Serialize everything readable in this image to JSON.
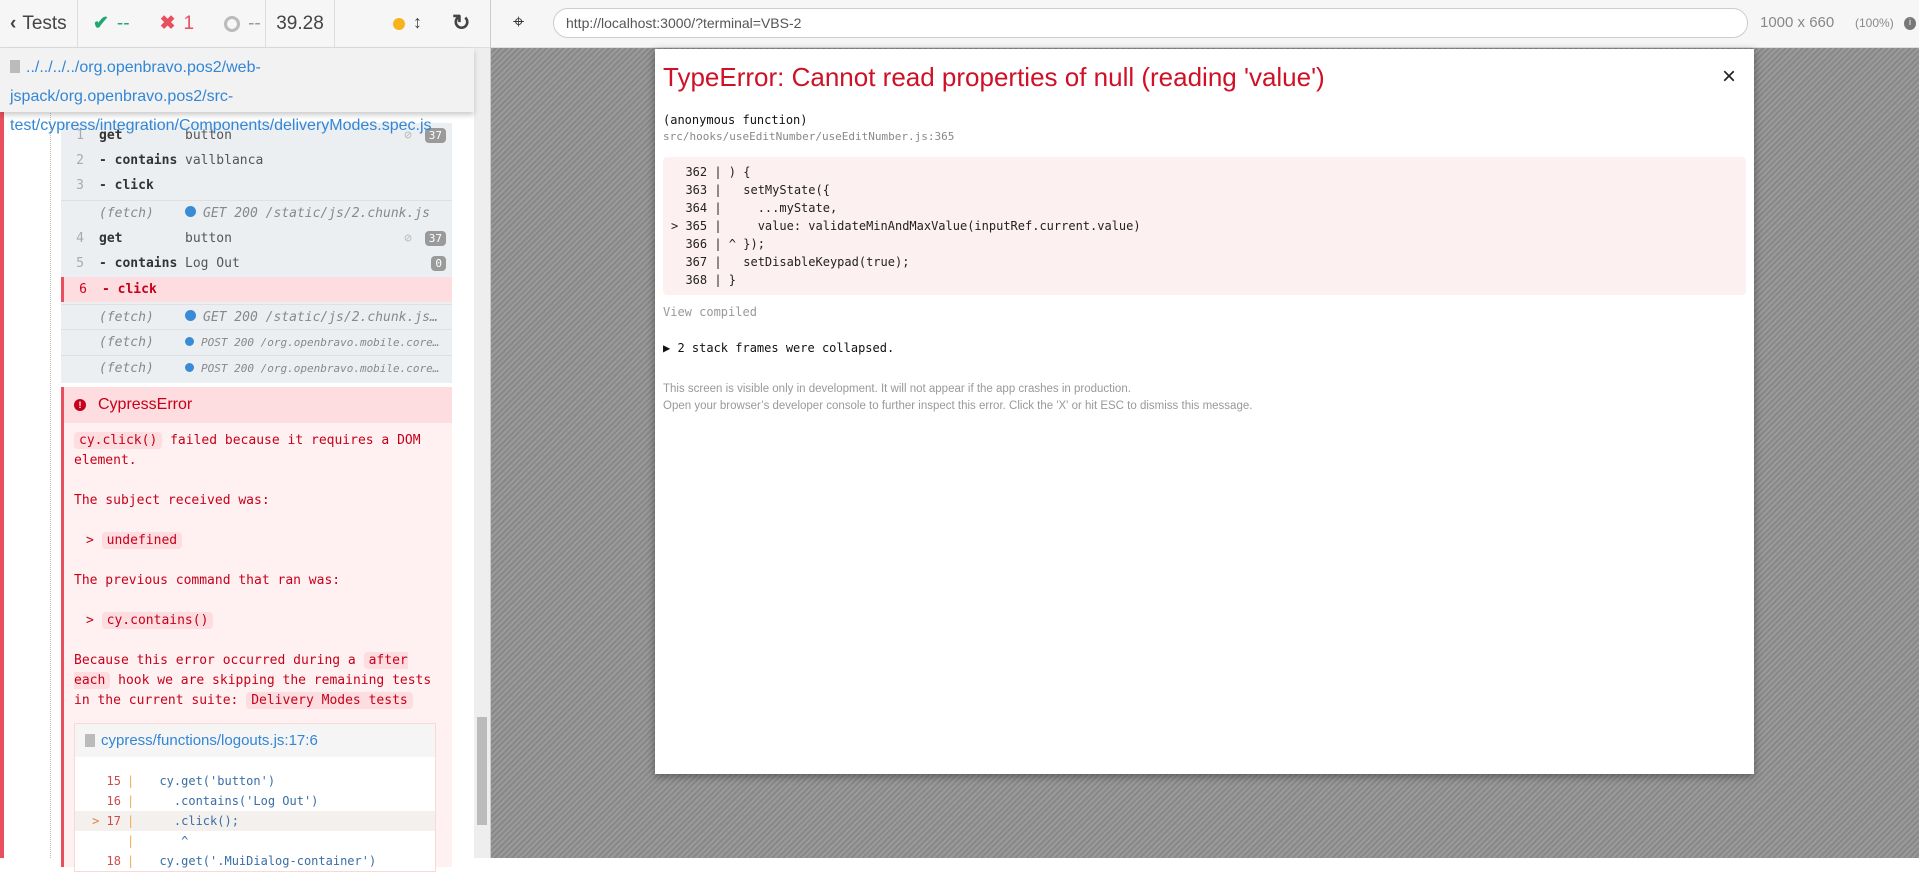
{
  "header": {
    "back_label": "Tests",
    "passed": "--",
    "failed": "1",
    "pending": "--",
    "duration": "39.28"
  },
  "browser": {
    "url": "http://localhost:3000/?terminal=VBS-2",
    "viewport": "1000 x 660",
    "zoom": "(100%)"
  },
  "spec_path": "../../../../org.openbravo.pos2/web-jspack/org.openbravo.pos2/src-test/cypress/integration/Components/deliveryModes.spec.js",
  "commands": [
    {
      "num": "1",
      "name": "get",
      "msg": "button",
      "badge": "37",
      "hidden": true
    },
    {
      "num": "2",
      "name": "- contains",
      "msg": "vallblanca"
    },
    {
      "num": "3",
      "name": "- click",
      "msg": ""
    },
    {
      "num": "",
      "name": "(fetch)",
      "msg": "GET 200 /static/js/2.chunk.js",
      "fetch": true
    },
    {
      "num": "4",
      "name": "get",
      "msg": "button",
      "badge": "37",
      "hidden": true
    },
    {
      "num": "5",
      "name": "- contains",
      "msg": "Log Out",
      "badge": "0"
    },
    {
      "num": "6",
      "name": "- click",
      "msg": "",
      "failed": true
    },
    {
      "num": "",
      "name": "(fetch)",
      "msg": "GET 200 /static/js/2.chunk.js…",
      "fetch": true
    },
    {
      "num": "",
      "name": "(fetch)",
      "msg": "POST 200 /org.openbravo.mobile.core…",
      "fetch": true
    },
    {
      "num": "",
      "name": "(fetch)",
      "msg": "POST 200 /org.openbravo.mobile.core…",
      "fetch": true
    }
  ],
  "error": {
    "name": "CypressError",
    "code1": "cy.click()",
    "text1": " failed because it requires a DOM element.",
    "text2": "The subject received was:",
    "code2": "undefined",
    "text3": "The previous command that ran was:",
    "code3": "cy.contains()",
    "text4a": "Because this error occurred during a ",
    "code4": "after each",
    "text4b": " hook we are skipping the remaining tests in the current suite: ",
    "code5": "Delivery Modes tests",
    "file": "cypress/functions/logouts.js:17:6",
    "lines": [
      {
        "marker": "",
        "num": "15",
        "code": "  cy.get('button')"
      },
      {
        "marker": "",
        "num": "16",
        "code": "    .contains('Log Out')"
      },
      {
        "marker": ">",
        "num": "17",
        "code": "    .click();"
      },
      {
        "marker": "",
        "num": "",
        "code": "     ^"
      },
      {
        "marker": "",
        "num": "18",
        "code": "  cy.get('.MuiDialog-container')"
      }
    ]
  },
  "overlay": {
    "title": "TypeError: Cannot read properties of null (reading 'value')",
    "close": "×",
    "function": "(anonymous function)",
    "location": "src/hooks/useEditNumber/useEditNumber.js:365",
    "code": "  362 | ) {\n  363 |   setMyState({\n  364 |     ...myState,\n> 365 |     value: validateMinAndMaxValue(inputRef.current.value)\n  366 | ^ });\n  367 |   setDisableKeypad(true);\n  368 | }",
    "view_compiled": "View compiled",
    "frames": "▶ 2 stack frames were collapsed.",
    "foot1": "This screen is visible only in development. It will not appear if the app crashes in production.",
    "foot2": "Open your browser’s developer console to further inspect this error.  Click the 'X' or hit ESC to dismiss this message."
  },
  "colors": {
    "fail": "#e94f5f",
    "link": "#3386d6",
    "error_title": "#ce1126",
    "pass": "#1fa971"
  }
}
